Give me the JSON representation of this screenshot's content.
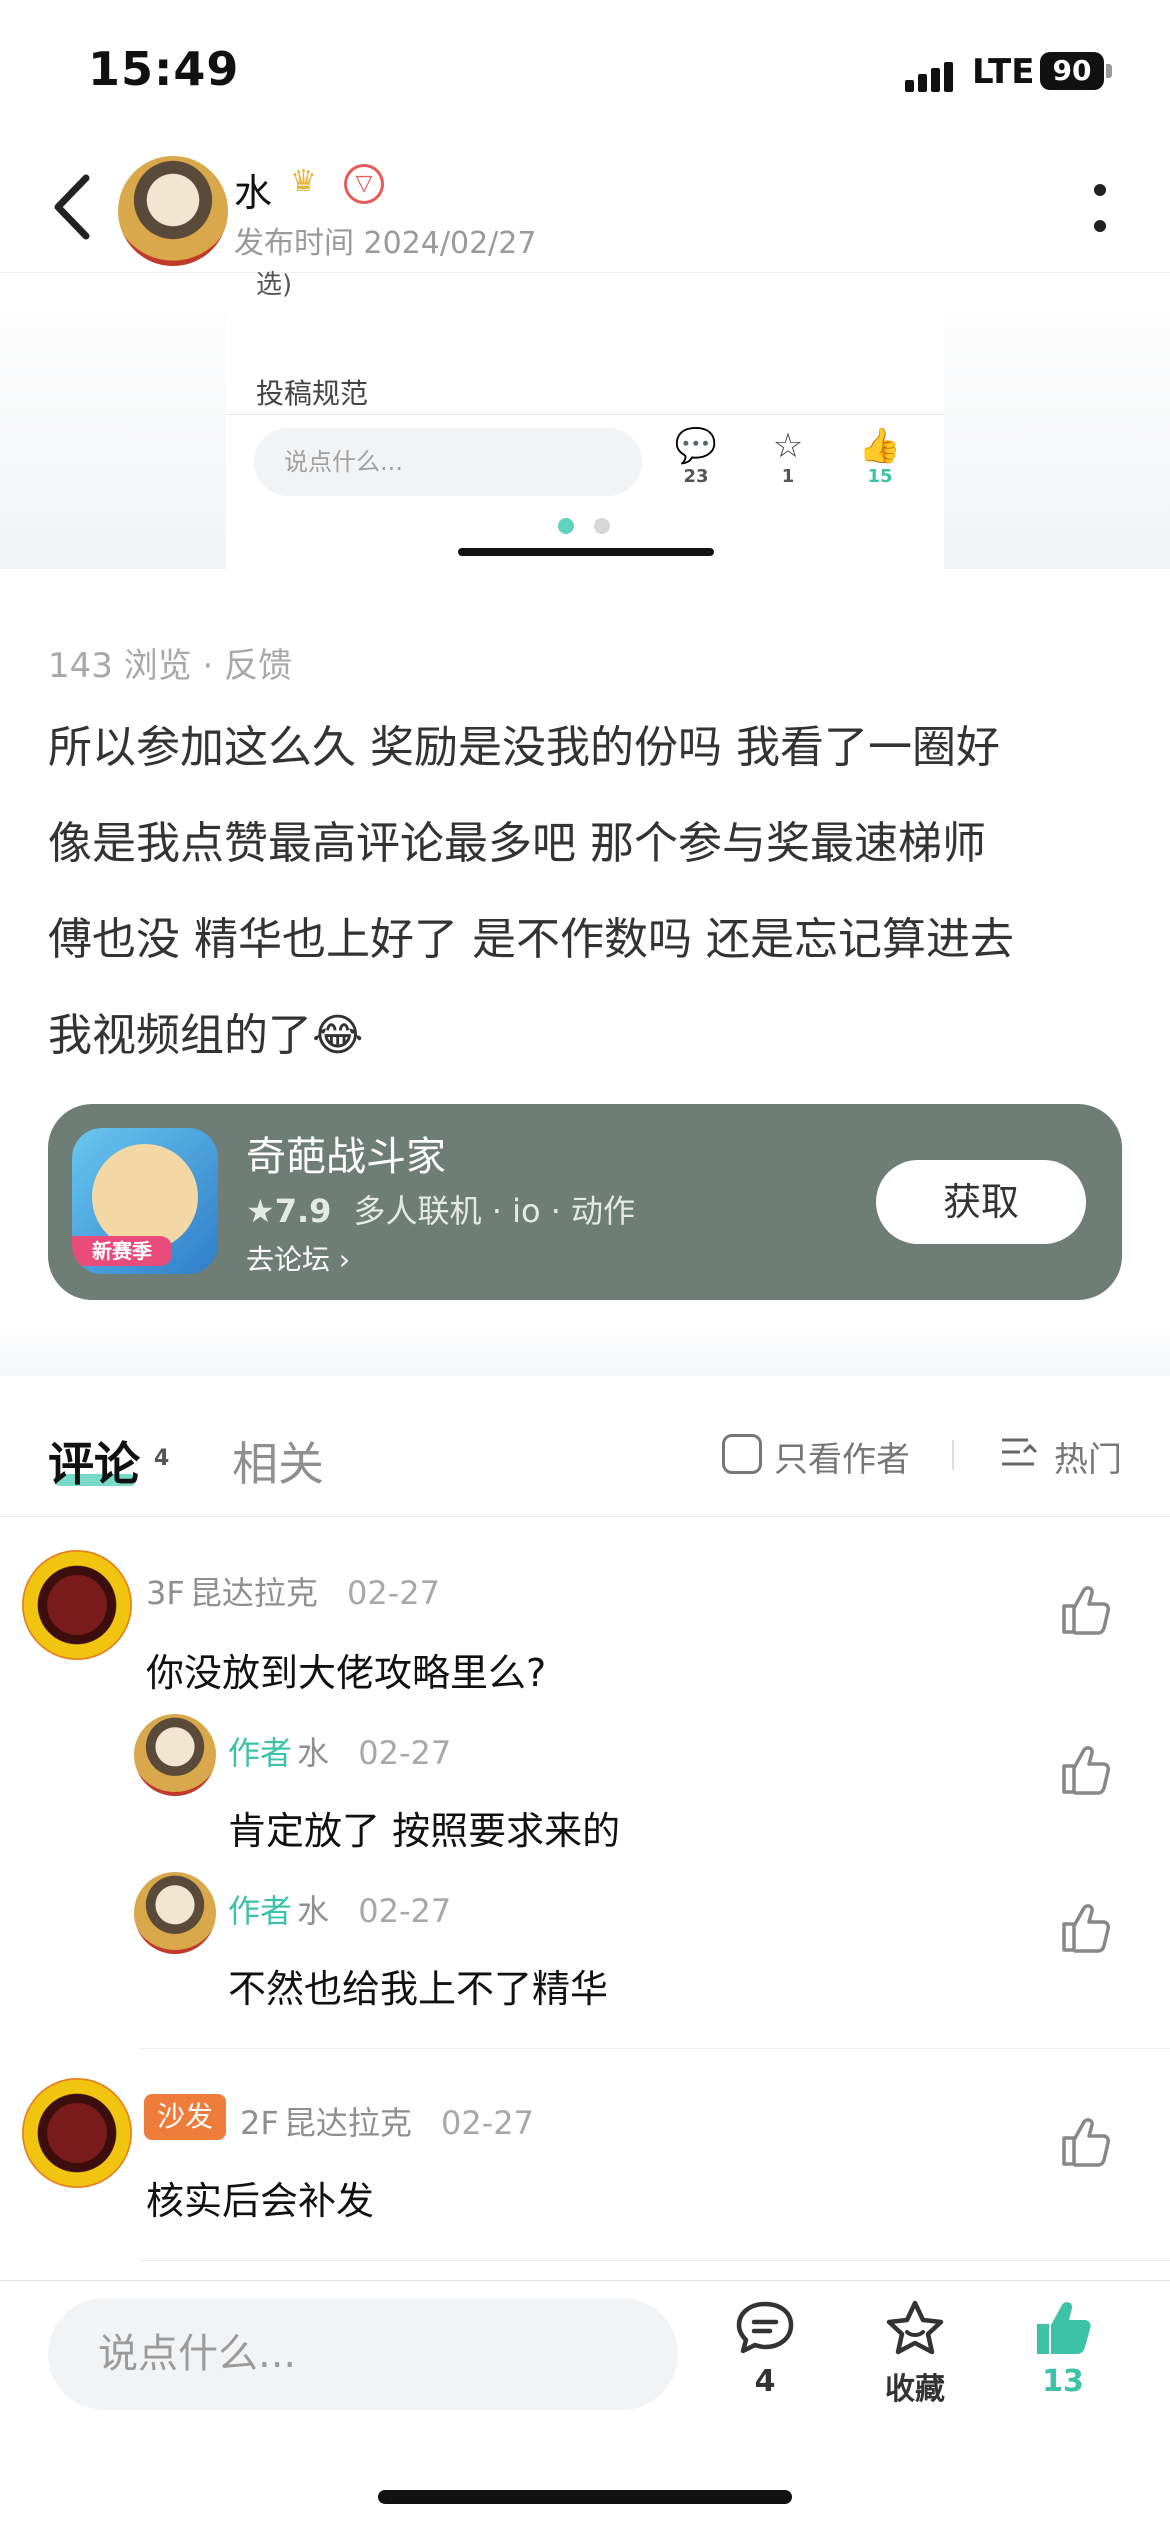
{
  "status_bar": {
    "time": "15:49",
    "network": "LTE",
    "battery": "90"
  },
  "header": {
    "author_name": "水",
    "publish_time": "发布时间 2024/02/27"
  },
  "embedded_screenshot": {
    "clipped_text": "选)",
    "rule_label": "投稿规范",
    "input_placeholder": "说点什么...",
    "comment_count": "23",
    "favorite_count": "1",
    "like_count": "15"
  },
  "post": {
    "meta": "143 浏览 · 反馈",
    "lines": [
      "所以参加这么久 奖励是没我的份吗 我看了一圈好",
      "像是我点赞最高评论最多吧 那个参与奖最速梯师",
      "傅也没 精华也上好了 是不作数吗 还是忘记算进去",
      "我视频组的了😂"
    ]
  },
  "game_card": {
    "name": "奇葩战斗家",
    "tag": "新赛季",
    "rating": "★7.9",
    "categories": "多人联机 · io · 动作",
    "forum_link": "去论坛",
    "get_button": "获取"
  },
  "tabs": {
    "comments": "评论",
    "comments_count": "4",
    "related": "相关",
    "only_author": "只看作者",
    "sort": "热门"
  },
  "comments": [
    {
      "floor": "3F",
      "user": "昆达拉克",
      "date": "02-27",
      "text": "你没放到大佬攻略里么?",
      "replies": [
        {
          "tag": "作者",
          "user": "水",
          "date": "02-27",
          "text": "肯定放了 按照要求来的"
        },
        {
          "tag": "作者",
          "user": "水",
          "date": "02-27",
          "text": "不然也给我上不了精华"
        }
      ]
    },
    {
      "badge": "沙发",
      "floor": "2F",
      "user": "昆达拉克",
      "date": "02-27",
      "text": "核实后会补发"
    }
  ],
  "bottom_bar": {
    "input_placeholder": "说点什么...",
    "comment_count": "4",
    "favorite_label": "收藏",
    "like_count": "13"
  },
  "colors": {
    "accent": "#3cc2a7",
    "sofa": "#ee7c3b",
    "game_card": "#6f7d77"
  }
}
